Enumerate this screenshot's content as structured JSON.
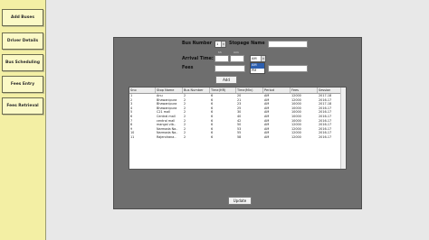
{
  "sidebar": {
    "items": [
      {
        "label": "Add Buses"
      },
      {
        "label": "Driver Details"
      },
      {
        "label": "Bus Scheduling"
      },
      {
        "label": "Fees Entry"
      },
      {
        "label": "Fees Retrieval"
      }
    ]
  },
  "form": {
    "bus_number_label": "Bus Number",
    "bus_number_value": "1",
    "stoppage_name_label": "Stopage Name",
    "arrival_time_label": "Arrival Time:",
    "hh_label": "hh",
    "mm_label": "mm",
    "period_value": "AM",
    "period_options": [
      "AM",
      "PM"
    ],
    "fees_label": "Fees",
    "add_label": "Add",
    "update_label": "Update"
  },
  "table": {
    "columns": [
      "Sno",
      "Stop Name",
      "Bus Number",
      "Time(HR)",
      "Time(Min)",
      "Period",
      "Fees",
      "Session"
    ],
    "rows": [
      [
        "1",
        "Anu",
        "2",
        "6",
        "20",
        "AM",
        "12000",
        "2017-18"
      ],
      [
        "2",
        "Bhawanipura",
        "2",
        "6",
        "21",
        "AM",
        "12000",
        "2016-17"
      ],
      [
        "3",
        "Bhawanipura",
        "2",
        "6",
        "23",
        "AM",
        "10000",
        "2017-18"
      ],
      [
        "4",
        "Bhawanipura",
        "2",
        "6",
        "25",
        "AM",
        "10000",
        "2016-17"
      ],
      [
        "5",
        "C21 mall",
        "2",
        "6",
        "30",
        "AM",
        "10000",
        "2016-17"
      ],
      [
        "6",
        "Central mall",
        "2",
        "6",
        "40",
        "AM",
        "10000",
        "2016-17"
      ],
      [
        "7",
        "central mall",
        "2",
        "6",
        "42",
        "AM",
        "10000",
        "2016-17"
      ],
      [
        "8",
        "mangal vib..",
        "2",
        "6",
        "50",
        "AM",
        "12000",
        "2016-17"
      ],
      [
        "9",
        "Narmada Na..",
        "2",
        "6",
        "53",
        "AM",
        "12000",
        "2016-17"
      ],
      [
        "10",
        "Narmada Na..",
        "2",
        "6",
        "55",
        "AM",
        "12000",
        "2016-17"
      ],
      [
        "11",
        "Rajendrana..",
        "2",
        "6",
        "58",
        "AM",
        "12000",
        "2016-17"
      ]
    ]
  }
}
